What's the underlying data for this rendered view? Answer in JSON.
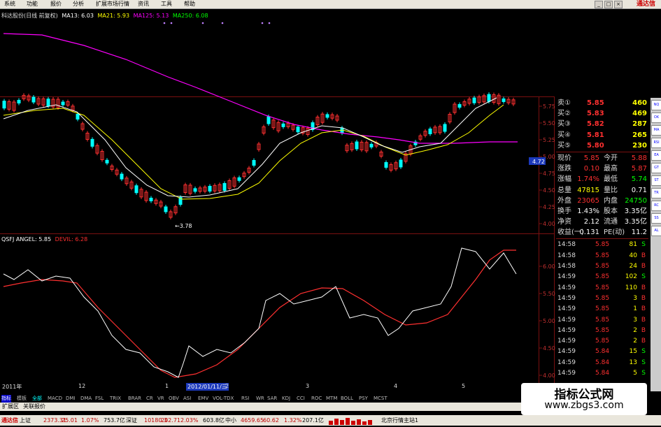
{
  "menu": [
    "系统",
    "功能",
    "报价",
    "分析",
    "扩展市场行情",
    "资讯",
    "工具",
    "帮助"
  ],
  "brand": "通达信",
  "main_legend": {
    "title": "科达股份(日线 前复权)",
    "items": [
      {
        "label": "MA13: 6.03",
        "color": "#ffffff"
      },
      {
        "label": "MA21: 5.93",
        "color": "#ffff00"
      },
      {
        "label": "MA125: 5.13",
        "color": "#ff00ff"
      },
      {
        "label": "MA250: 6.08",
        "color": "#00ff00"
      }
    ]
  },
  "indicator_legend": {
    "items": [
      {
        "label": "QSFJ ANGEL: 5.85",
        "color": "#ffffff"
      },
      {
        "label": "DEVIL: 6.28",
        "color": "#ff3030"
      }
    ]
  },
  "price_axis": [
    "5.75",
    "5.50",
    "5.25",
    "5.00",
    "4.75",
    "4.50",
    "4.25",
    "4.00"
  ],
  "price_marker": "4.72",
  "low_label": "←3.78",
  "ind_axis": [
    "6.00",
    "5.50",
    "5.00",
    "4.50",
    "4.00"
  ],
  "quote": {
    "asks": [
      {
        "label": "卖①",
        "price": "5.85",
        "vol": "460"
      },
      {
        "label": "买②",
        "price": "5.83",
        "vol": "469"
      },
      {
        "label": "买③",
        "price": "5.82",
        "vol": "287"
      },
      {
        "label": "买④",
        "price": "5.81",
        "vol": "265"
      },
      {
        "label": "买⑤",
        "price": "5.80",
        "vol": "230"
      }
    ],
    "stats": [
      {
        "l1": "现价",
        "v1": "5.85",
        "l2": "今开",
        "v2": "5.88",
        "c1": "#ff3030",
        "c2": "#ff3030"
      },
      {
        "l1": "涨跌",
        "v1": "0.10",
        "l2": "最高",
        "v2": "5.87",
        "c1": "#ff3030",
        "c2": "#ff3030"
      },
      {
        "l1": "涨幅",
        "v1": "1.74%",
        "l2": "最低",
        "v2": "5.74",
        "c1": "#ff3030",
        "c2": "#00ff00"
      },
      {
        "l1": "总量",
        "v1": "47815",
        "l2": "量比",
        "v2": "0.71",
        "c1": "#ffff00",
        "c2": "#ffffff"
      },
      {
        "l1": "外盘",
        "v1": "23065",
        "l2": "内盘",
        "v2": "24750",
        "c1": "#ff3030",
        "c2": "#00ff00"
      },
      {
        "l1": "换手",
        "v1": "1.43%",
        "l2": "股本",
        "v2": "3.35亿",
        "c1": "#ffffff",
        "c2": "#ffffff"
      },
      {
        "l1": "净资",
        "v1": "2.12",
        "l2": "流通",
        "v2": "3.35亿",
        "c1": "#ffffff",
        "c2": "#ffffff"
      },
      {
        "l1": "收益(一)",
        "v1": "0.131",
        "l2": "PE(动)",
        "v2": "11.2",
        "c1": "#ffffff",
        "c2": "#ffffff"
      }
    ],
    "ticks": [
      {
        "time": "14:58",
        "price": "5.85",
        "vol": "81",
        "side": "S"
      },
      {
        "time": "14:58",
        "price": "5.85",
        "vol": "40",
        "side": "B"
      },
      {
        "time": "14:58",
        "price": "5.85",
        "vol": "24",
        "side": "B"
      },
      {
        "time": "14:59",
        "price": "5.85",
        "vol": "102",
        "side": "S"
      },
      {
        "time": "14:59",
        "price": "5.85",
        "vol": "110",
        "side": "B"
      },
      {
        "time": "14:59",
        "price": "5.85",
        "vol": "3",
        "side": "B"
      },
      {
        "time": "14:59",
        "price": "5.85",
        "vol": "1",
        "side": "B"
      },
      {
        "time": "14:59",
        "price": "5.85",
        "vol": "3",
        "side": "B"
      },
      {
        "time": "14:59",
        "price": "5.85",
        "vol": "2",
        "side": "B"
      },
      {
        "time": "14:59",
        "price": "5.85",
        "vol": "2",
        "side": "B"
      },
      {
        "time": "14:59",
        "price": "5.84",
        "vol": "15",
        "side": "S"
      },
      {
        "time": "14:59",
        "price": "5.84",
        "vol": "13",
        "side": "S"
      },
      {
        "time": "14:59",
        "price": "5.84",
        "vol": "5",
        "side": "S"
      }
    ]
  },
  "time_axis": {
    "first": "2011年",
    "items": [
      "12",
      "1",
      "2",
      "3",
      "4",
      "5"
    ],
    "highlight": "2012/01/11/三"
  },
  "indicator_tabs": [
    "指标",
    "模板",
    "全部",
    "MACD",
    "DMI",
    "DMA",
    "FSL",
    "TRIX",
    "BRAR",
    "CR",
    "VR",
    "OBV",
    "ASI",
    "EMV",
    "VOL-TDX",
    "RSI",
    "WR",
    "SAR",
    "KDJ",
    "CCI",
    "ROC",
    "MTM",
    "BOLL",
    "PSY",
    "MCST"
  ],
  "ext_bar": [
    "扩展区",
    "关联报价"
  ],
  "status": {
    "brand": "通达信",
    "items": [
      {
        "t": "上证",
        "c": "#000"
      },
      {
        "t": "2373.31",
        "c": "#c00000"
      },
      {
        "t": "25.01",
        "c": "#c00000"
      },
      {
        "t": "1.07%",
        "c": "#c00000"
      },
      {
        "t": "753.7亿",
        "c": "#000"
      },
      {
        "t": "深证",
        "c": "#000"
      },
      {
        "t": "10180.3",
        "c": "#c00000"
      },
      {
        "t": "202.71",
        "c": "#c00000"
      },
      {
        "t": "2.03%",
        "c": "#c00000"
      },
      {
        "t": "603.8亿",
        "c": "#000"
      },
      {
        "t": "中小",
        "c": "#000"
      },
      {
        "t": "4659.65",
        "c": "#c00000"
      },
      {
        "t": "60.62",
        "c": "#c00000"
      },
      {
        "t": "1.32%",
        "c": "#c00000"
      },
      {
        "t": "207.1亿",
        "c": "#000"
      },
      {
        "t": "北京行情主站1",
        "c": "#000"
      }
    ]
  },
  "watermark": {
    "line1": "指标公式网",
    "line2": "www.zbgs3.com"
  },
  "sidebar_tabs": [
    "NQ",
    "OK",
    "MA",
    "RSI",
    "EA",
    "GT",
    "ST",
    "TR",
    "RC",
    "SS",
    "AL"
  ],
  "colors": {
    "up": "#ff3030",
    "down": "#00ffff",
    "ma13": "#ffffff",
    "ma21": "#ffff00",
    "ma125": "#ff00ff",
    "angel": "#ffffff",
    "devil": "#ff3030"
  }
}
